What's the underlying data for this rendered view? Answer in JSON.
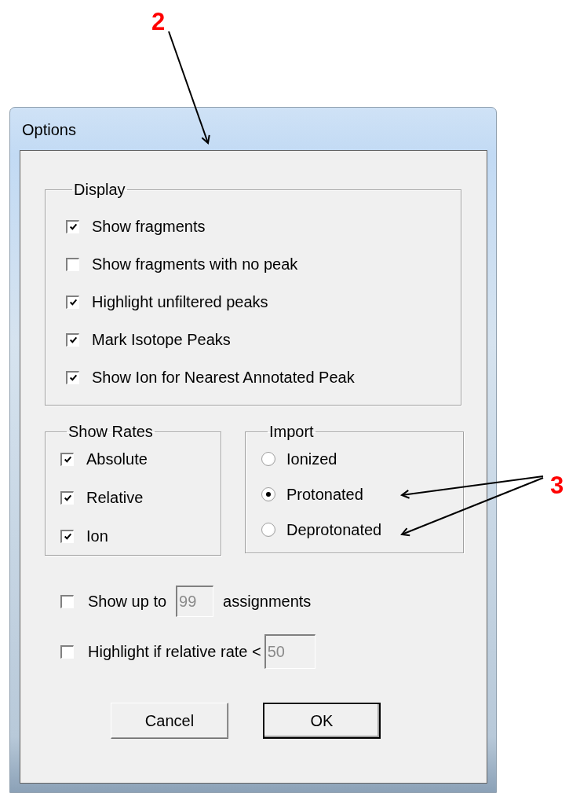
{
  "annotations": [
    {
      "label": "2"
    },
    {
      "label": "3"
    }
  ],
  "window": {
    "title": "Options"
  },
  "display": {
    "title": "Display",
    "options": [
      {
        "label": "Show fragments",
        "checked": true
      },
      {
        "label": "Show fragments with no peak",
        "checked": false
      },
      {
        "label": "Highlight unfiltered peaks",
        "checked": true
      },
      {
        "label": "Mark Isotope Peaks",
        "checked": true
      },
      {
        "label": "Show Ion for Nearest Annotated Peak",
        "checked": true
      }
    ]
  },
  "show_rates": {
    "title": "Show Rates",
    "options": [
      {
        "label": "Absolute",
        "checked": true
      },
      {
        "label": "Relative",
        "checked": true
      },
      {
        "label": "Ion",
        "checked": true
      }
    ]
  },
  "import": {
    "title": "Import",
    "options": [
      {
        "label": "Ionized",
        "selected": false
      },
      {
        "label": "Protonated",
        "selected": true
      },
      {
        "label": "Deprotonated",
        "selected": false
      }
    ]
  },
  "limits": [
    {
      "checked": false,
      "label": "Show up to",
      "value": "99",
      "suffix": "assignments",
      "disabled": true
    },
    {
      "checked": false,
      "label": "Highlight if relative rate <",
      "value": "50",
      "disabled": true
    }
  ],
  "buttons": [
    {
      "label": "Cancel",
      "default": false
    },
    {
      "label": "OK",
      "default": true
    }
  ]
}
